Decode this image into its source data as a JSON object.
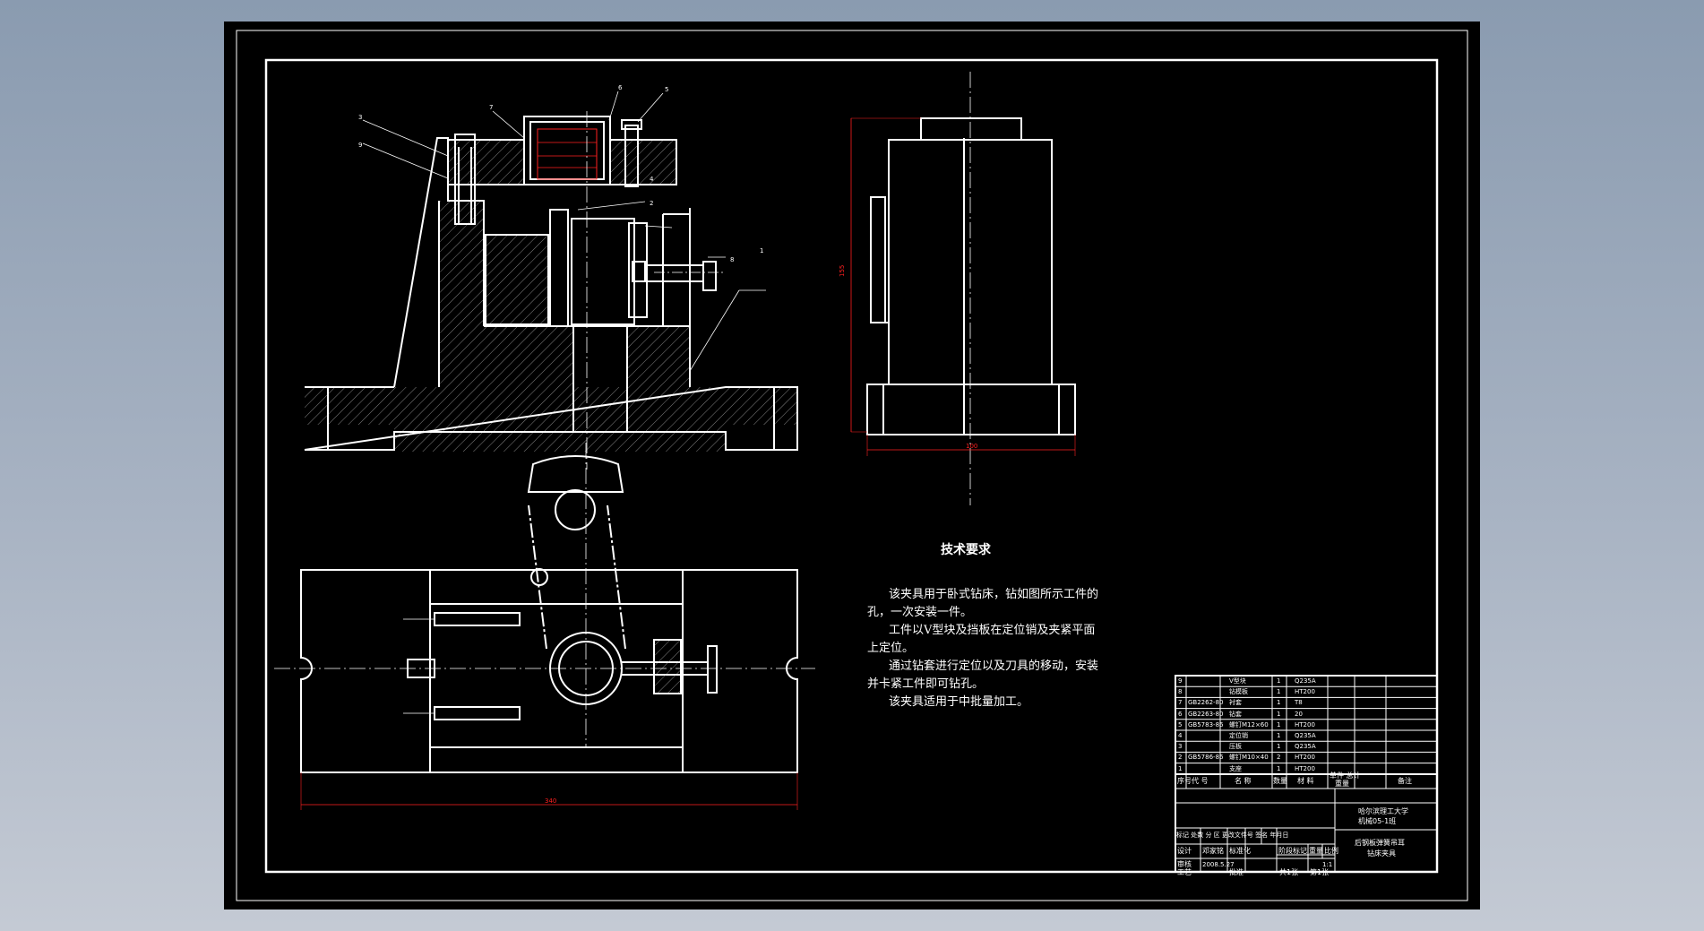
{
  "technical_requirements": {
    "title": "技术要求",
    "paragraphs": [
      "该夹具用于卧式钻床，钻如图所示工件的",
      "孔，一次安装一件。",
      "工件以V型块及挡板在定位销及夹紧平面",
      "上定位。",
      "通过钻套进行定位以及刀具的移动，安装",
      "并卡紧工件即可钻孔。",
      "该夹具适用于中批量加工。"
    ]
  },
  "dimensions": {
    "bottom_width": "340",
    "side_height": "155",
    "side_width": "100"
  },
  "bom": [
    {
      "no": "9",
      "code": "",
      "name": "V型块",
      "qty": "1",
      "material": "Q235A"
    },
    {
      "no": "8",
      "code": "",
      "name": "钻模板",
      "qty": "1",
      "material": "HT200"
    },
    {
      "no": "7",
      "code": "GB2262-80",
      "name": "衬套",
      "qty": "1",
      "material": "T8"
    },
    {
      "no": "6",
      "code": "GB2263-80",
      "name": "钻套",
      "qty": "1",
      "material": "20"
    },
    {
      "no": "5",
      "code": "GB5783-86",
      "name": "螺钉M12×60",
      "qty": "1",
      "material": "HT200"
    },
    {
      "no": "4",
      "code": "",
      "name": "定位销",
      "qty": "1",
      "material": "Q235A"
    },
    {
      "no": "3",
      "code": "",
      "name": "压板",
      "qty": "1",
      "material": "Q235A"
    },
    {
      "no": "2",
      "code": "GB5786-86",
      "name": "螺钉M10×40",
      "qty": "2",
      "material": "HT200"
    },
    {
      "no": "1",
      "code": "",
      "name": "支座",
      "qty": "1",
      "material": "HT200"
    }
  ],
  "bom_header": {
    "no": "序号",
    "code": "代 号",
    "name": "名 称",
    "qty": "数量",
    "material": "材 料",
    "weight": "单件 总计",
    "weight2": "重量",
    "remark": "备注"
  },
  "title_block": {
    "school": "哈尔滨理工大学",
    "class": "机械05-1班",
    "part_name_1": "后钢板弹簧吊耳",
    "part_name_2": "钻床夹具",
    "mark_row": "标记 处数 分 区 更改文件号 签名 年月日",
    "designer_label": "设计",
    "designer": "邓家铭",
    "standardize": "标准化",
    "date": "2008.5.27",
    "review": "审核",
    "process": "工艺",
    "approve": "批准",
    "stage": "阶段标记",
    "weight": "重量",
    "scale": "比例",
    "scale_value": "1:1",
    "sheets": "共1张",
    "sheet": "第1张"
  }
}
